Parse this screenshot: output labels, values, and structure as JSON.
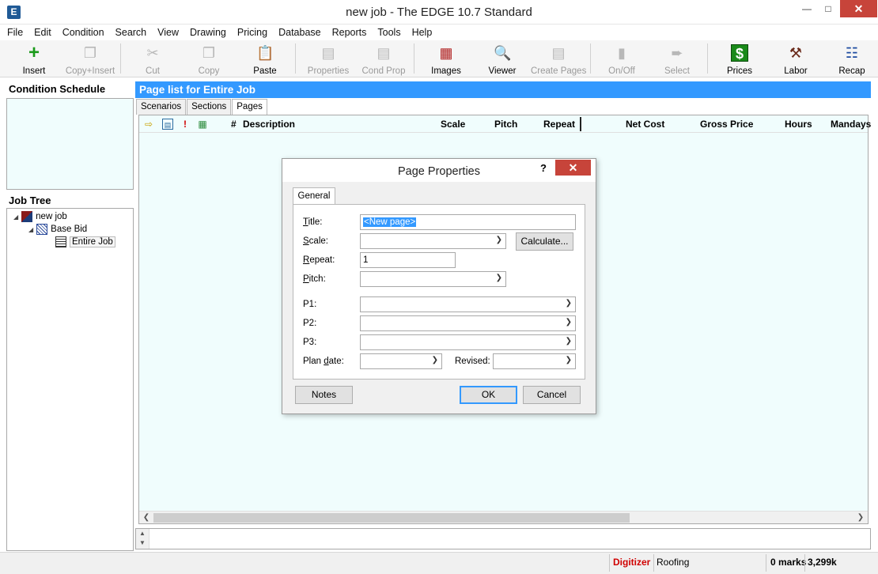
{
  "window": {
    "app_icon": "E",
    "title": "new job - The EDGE 10.7 Standard",
    "minimize": "—",
    "maximize": "□",
    "close": "✕"
  },
  "menu": [
    "File",
    "Edit",
    "Condition",
    "Search",
    "View",
    "Drawing",
    "Pricing",
    "Database",
    "Reports",
    "Tools",
    "Help"
  ],
  "toolbar": {
    "insert": "Insert",
    "copy_insert": "Copy+Insert",
    "cut": "Cut",
    "copy": "Copy",
    "paste": "Paste",
    "properties": "Properties",
    "cond_prop": "Cond Prop",
    "images": "Images",
    "viewer": "Viewer",
    "create_pages": "Create Pages",
    "on_off": "On/Off",
    "select": "Select",
    "prices": "Prices",
    "labor": "Labor",
    "recap": "Recap"
  },
  "left": {
    "condition_schedule": "Condition Schedule",
    "job_tree": "Job Tree",
    "tree": [
      "new job",
      "Base Bid",
      "Entire Job"
    ]
  },
  "main": {
    "header": "Page list for Entire Job",
    "tabs": [
      "Scenarios",
      "Sections",
      "Pages"
    ],
    "columns": [
      "#",
      "Description",
      "Scale",
      "Pitch",
      "Repeat",
      "Net Cost",
      "Gross Price",
      "Hours",
      "Mandays"
    ]
  },
  "dialog": {
    "title": "Page Properties",
    "help": "?",
    "close": "✕",
    "tab": "General",
    "labels": {
      "title_label_u": "T",
      "title_label_rest": "itle:",
      "scale_u": "S",
      "scale_rest": "cale:",
      "repeat_u": "R",
      "repeat_rest": "epeat:",
      "pitch_u": "P",
      "pitch_rest": "itch:",
      "p1": "P1:",
      "p2": "P2:",
      "p3": "P3:",
      "plan_date_pre": "Plan ",
      "plan_date_u": "d",
      "plan_date_rest": "ate:",
      "revised": "Revised:"
    },
    "values": {
      "title": "<New page>",
      "repeat": "1"
    },
    "buttons": {
      "calculate": "Calculate...",
      "notes": "Notes",
      "ok": "OK",
      "cancel": "Cancel"
    }
  },
  "status": {
    "digitizer": "Digitizer",
    "digitizer_color": "#d00000",
    "mode": "Roofing",
    "marks": "0 marks",
    "memory": "3,299k"
  },
  "colors": {
    "header_blue": "#3399ff",
    "grid_bg": "#f0fdfd",
    "close_red": "#c7443a"
  }
}
